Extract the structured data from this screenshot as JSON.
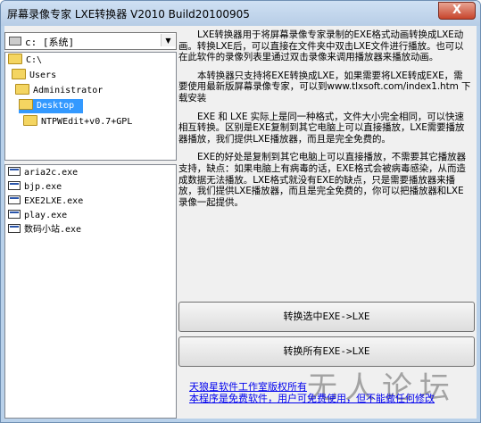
{
  "window": {
    "title": "屏幕录像专家 LXE转换器 V2010 Build20100905",
    "close_label": "X"
  },
  "drive": {
    "value": "c: [系统]"
  },
  "directories": [
    {
      "label": "C:\\",
      "selected": false
    },
    {
      "label": "Users",
      "selected": false
    },
    {
      "label": "Administrator",
      "selected": false
    },
    {
      "label": "Desktop",
      "selected": true
    },
    {
      "label": "NTPWEdit+v0.7+GPL",
      "selected": false
    }
  ],
  "files": [
    "aria2c.exe",
    "bjp.exe",
    "EXE2LXE.exe",
    "play.exe",
    "数码小站.exe"
  ],
  "description": [
    "LXE转换器用于将屏幕录像专家录制的EXE格式动画转换成LXE动画。转换LXE后，可以直接在文件夹中双击LXE文件进行播放。也可以在此软件的录像列表里通过双击录像来调用播放器来播放动画。",
    "本转换器只支持将EXE转换成LXE，如果需要将LXE转成EXE，需要使用最新版屏幕录像专家，可以到www.tlxsoft.com/index1.htm 下载安装",
    "EXE 和 LXE 实际上是同一种格式，文件大小完全相同，可以快速相互转换。区别是EXE复制到其它电脑上可以直接播放，LXE需要播放器播放，我们提供LXE播放器，而且是完全免费的。",
    "EXE的好处是复制到其它电脑上可以直接播放，不需要其它播放器支持，缺点：如果电脑上有病毒的话，EXE格式会被病毒感染，从而造成数据无法播放。LXE格式就没有EXE的缺点，只是需要播放器来播放，我们提供LXE播放器，而且是完全免费的，你可以把播放器和LXE录像一起提供。"
  ],
  "buttons": {
    "convert_selected": "转换选中EXE->LXE",
    "convert_all": "转换所有EXE->LXE"
  },
  "links": {
    "studio": "天狼星软件工作室版权所有",
    "notice": "本程序是免费软件，用户可免费使用，但不能做任何修改"
  },
  "watermark": "无人论坛"
}
